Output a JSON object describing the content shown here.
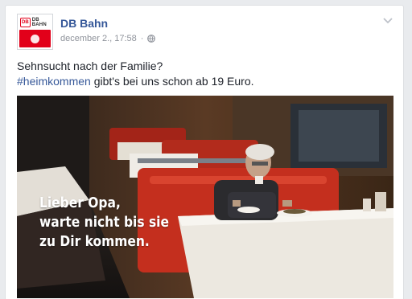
{
  "post": {
    "page_name": "DB Bahn",
    "date": "december 2., 17:58",
    "separator": "·",
    "text_line1": "Sehnsucht nach der Familie?",
    "hashtag": "#heimkommen",
    "text_line2_rest": " gibt's bei uns schon ab 19 Euro.",
    "avatar_brand": "DB BAHN",
    "avatar_logo": "DB"
  },
  "photo": {
    "caption_lines": [
      "Lieber Opa,",
      "warte nicht bis sie",
      "zu Dir kommen."
    ]
  },
  "icons": {
    "privacy": "globe-icon",
    "options": "chevron-down-icon"
  },
  "colors": {
    "link": "#365899",
    "brand_red": "#e2001a",
    "meta_gray": "#90949c"
  }
}
